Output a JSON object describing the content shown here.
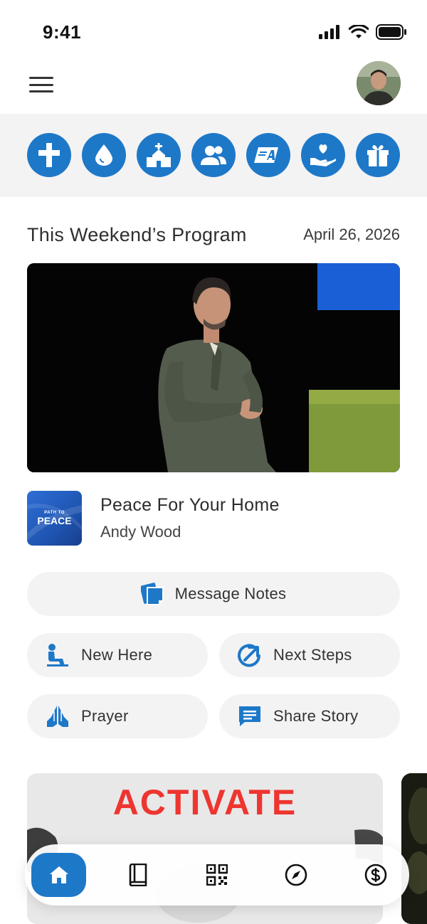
{
  "status_bar": {
    "time": "9:41"
  },
  "quick_actions": [
    {
      "icon": "cross-icon"
    },
    {
      "icon": "water-drop-icon"
    },
    {
      "icon": "church-icon"
    },
    {
      "icon": "people-icon"
    },
    {
      "icon": "brand-logo-icon"
    },
    {
      "icon": "heart-hand-icon"
    },
    {
      "icon": "gift-icon"
    }
  ],
  "program": {
    "title": "This Weekend’s Program",
    "date": "April 26, 2026"
  },
  "sermon": {
    "thumb_small": "PATH TO",
    "thumb_big": "PEACE",
    "title": "Peace For Your Home",
    "speaker": "Andy Wood"
  },
  "buttons": {
    "message_notes": "Message Notes",
    "new_here": "New Here",
    "next_steps": "Next Steps",
    "prayer": "Prayer",
    "share_story": "Share Story"
  },
  "carousel": {
    "headline": "ACTIVATE"
  },
  "tabs": [
    {
      "icon": "home-icon",
      "active": true
    },
    {
      "icon": "book-icon",
      "active": false
    },
    {
      "icon": "qr-code-icon",
      "active": false
    },
    {
      "icon": "compass-icon",
      "active": false
    },
    {
      "icon": "dollar-icon",
      "active": false
    }
  ],
  "colors": {
    "accent": "#1e78c8",
    "background": "#ffffff",
    "strip": "#f3f3f3",
    "carousel_red": "#ee3530"
  }
}
